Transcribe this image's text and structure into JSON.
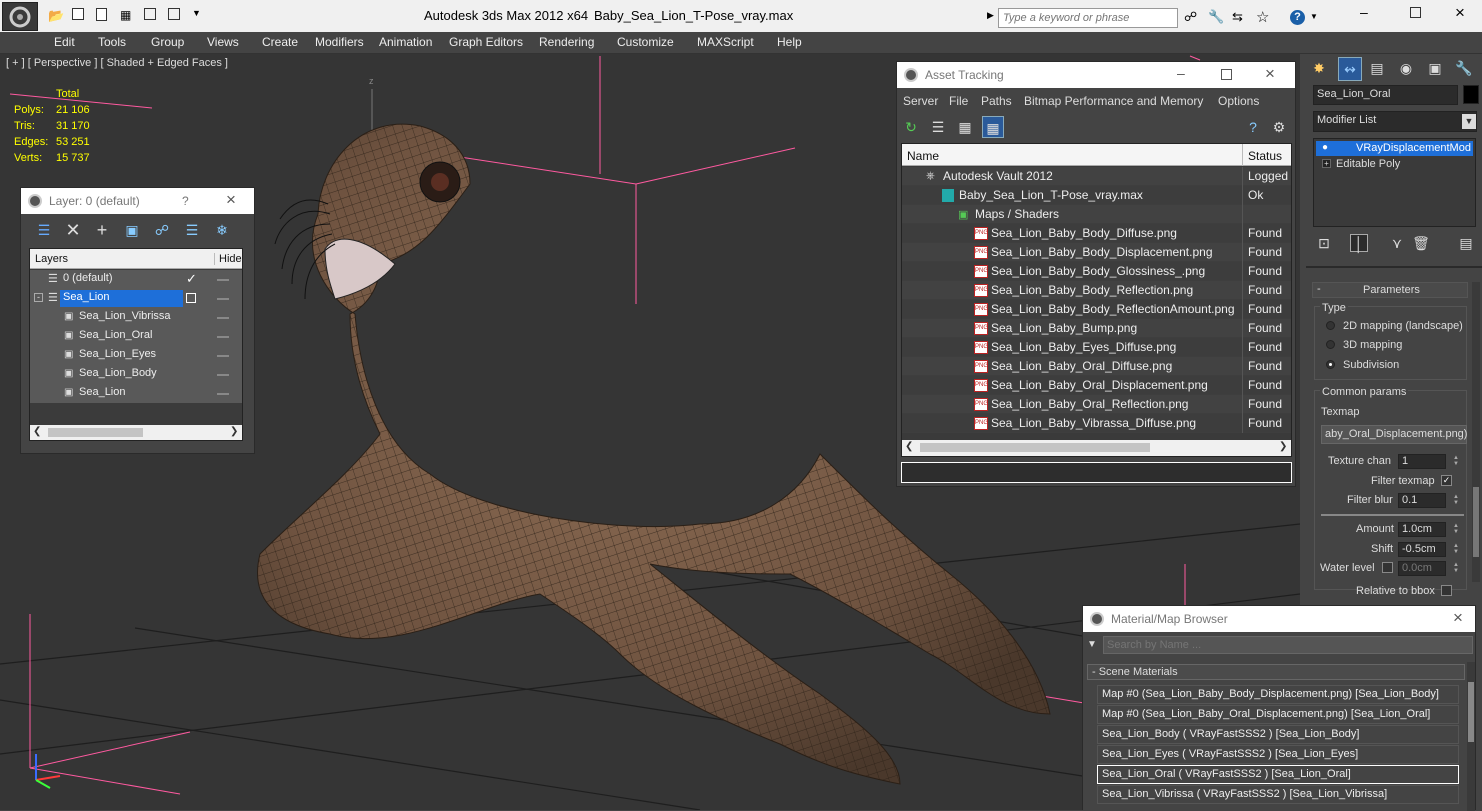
{
  "app": {
    "title": "Autodesk 3ds Max  2012 x64",
    "file": "Baby_Sea_Lion_T-Pose_vray.max",
    "search_placeholder": "Type a keyword or phrase"
  },
  "menus": [
    "Edit",
    "Tools",
    "Group",
    "Views",
    "Create",
    "Modifiers",
    "Animation",
    "Graph Editors",
    "Rendering",
    "Customize",
    "MAXScript",
    "Help"
  ],
  "viewport": {
    "label": "[ + ] [ Perspective ] [ Shaded + Edged Faces ]",
    "stats": {
      "header": "Total",
      "rows": [
        {
          "k": "Polys:",
          "v": "21 106"
        },
        {
          "k": "Tris:",
          "v": "31 170"
        },
        {
          "k": "Edges:",
          "v": "53 251"
        },
        {
          "k": "Verts:",
          "v": "15 737"
        }
      ]
    },
    "axis_z": "z"
  },
  "layer_dialog": {
    "title": "Layer: 0 (default)",
    "help": "?",
    "col_layers": "Layers",
    "col_hide": "Hide",
    "items": [
      {
        "name": "0 (default)"
      },
      {
        "name": "Sea_Lion"
      },
      {
        "name": "Sea_Lion_Vibrissa"
      },
      {
        "name": "Sea_Lion_Oral"
      },
      {
        "name": "Sea_Lion_Eyes"
      },
      {
        "name": "Sea_Lion_Body"
      },
      {
        "name": "Sea_Lion"
      }
    ]
  },
  "asset_tracking": {
    "title": "Asset Tracking",
    "menus": [
      "Server",
      "File",
      "Paths",
      "Bitmap Performance and Memory",
      "Options"
    ],
    "col_name": "Name",
    "col_status": "Status",
    "rows": [
      {
        "name": "Autodesk Vault 2012",
        "status": "Logged"
      },
      {
        "name": "Baby_Sea_Lion_T-Pose_vray.max",
        "status": "Ok"
      },
      {
        "name": "Maps / Shaders",
        "status": ""
      },
      {
        "name": "Sea_Lion_Baby_Body_Diffuse.png",
        "status": "Found"
      },
      {
        "name": "Sea_Lion_Baby_Body_Displacement.png",
        "status": "Found"
      },
      {
        "name": "Sea_Lion_Baby_Body_Glossiness_.png",
        "status": "Found"
      },
      {
        "name": "Sea_Lion_Baby_Body_Reflection.png",
        "status": "Found"
      },
      {
        "name": "Sea_Lion_Baby_Body_ReflectionAmount.png",
        "status": "Found"
      },
      {
        "name": "Sea_Lion_Baby_Bump.png",
        "status": "Found"
      },
      {
        "name": "Sea_Lion_Baby_Eyes_Diffuse.png",
        "status": "Found"
      },
      {
        "name": "Sea_Lion_Baby_Oral_Diffuse.png",
        "status": "Found"
      },
      {
        "name": "Sea_Lion_Baby_Oral_Displacement.png",
        "status": "Found"
      },
      {
        "name": "Sea_Lion_Baby_Oral_Reflection.png",
        "status": "Found"
      },
      {
        "name": "Sea_Lion_Baby_Vibrassa_Diffuse.png",
        "status": "Found"
      }
    ],
    "png_badge": "PNG"
  },
  "command_panel": {
    "object_name": "Sea_Lion_Oral",
    "modifier_list": "Modifier List",
    "stack": [
      "VRayDisplacementMod",
      "Editable Poly"
    ],
    "rollout": "Parameters",
    "type_label": "Type",
    "types": [
      "2D mapping (landscape)",
      "3D mapping",
      "Subdivision"
    ],
    "common": "Common params",
    "texmap_label": "Texmap",
    "texmap_value": "aby_Oral_Displacement.png)",
    "texture_chan_label": "Texture chan",
    "texture_chan_value": "1",
    "filter_texmap_label": "Filter texmap",
    "filter_blur_label": "Filter blur",
    "filter_blur_value": "0.1",
    "amount_label": "Amount",
    "amount_value": "1.0cm",
    "shift_label": "Shift",
    "shift_value": "-0.5cm",
    "water_label": "Water level",
    "water_value": "0.0cm",
    "bbox_label": "Relative to bbox"
  },
  "material_browser": {
    "title": "Material/Map Browser",
    "search_placeholder": "Search by Name ...",
    "section": "- Scene Materials",
    "items": [
      "Map #0 (Sea_Lion_Baby_Body_Displacement.png) [Sea_Lion_Body]",
      "Map #0 (Sea_Lion_Baby_Oral_Displacement.png) [Sea_Lion_Oral]",
      "Sea_Lion_Body  ( VRayFastSSS2 )  [Sea_Lion_Body]",
      "Sea_Lion_Eyes  ( VRayFastSSS2 )  [Sea_Lion_Eyes]",
      "Sea_Lion_Oral  ( VRayFastSSS2 )  [Sea_Lion_Oral]",
      "Sea_Lion_Vibrissa  ( VRayFastSSS2 )  [Sea_Lion_Vibrissa]"
    ]
  }
}
